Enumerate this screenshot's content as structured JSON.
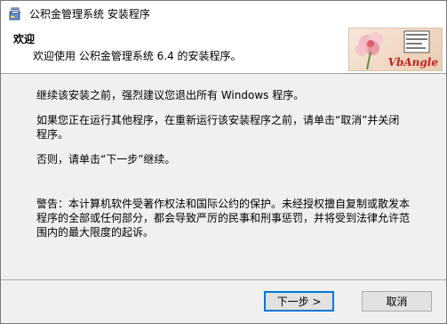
{
  "window": {
    "title": "公积金管理系统 安装程序"
  },
  "header": {
    "title": "欢迎",
    "subtitle": "欢迎使用 公积金管理系统 6.4 的安装程序。",
    "logo_text": "VbAngle"
  },
  "body": {
    "para1": "继续该安装之前，强烈建议您退出所有 Windows 程序。",
    "para2": "如果您正在运行其他程序，在重新运行该安装程序之前，请单击“取消”并关闭程序。",
    "para3": "否则，请单击“下一步”继续。",
    "warning": "警告：本计算机软件受著作权法和国际公约的保护。未经授权擅自复制或散发本程序的全部或任何部分，都会导致严厉的民事和刑事惩罚，并将受到法律允许范围内的最大限度的起诉。"
  },
  "buttons": {
    "next": "下一步 >",
    "cancel": "取消"
  },
  "colors": {
    "logo_text": "#c51f1f",
    "default_button_border": "#0078d7"
  },
  "icons": {
    "app": "installer-icon",
    "logo": "flower-logo-image"
  }
}
